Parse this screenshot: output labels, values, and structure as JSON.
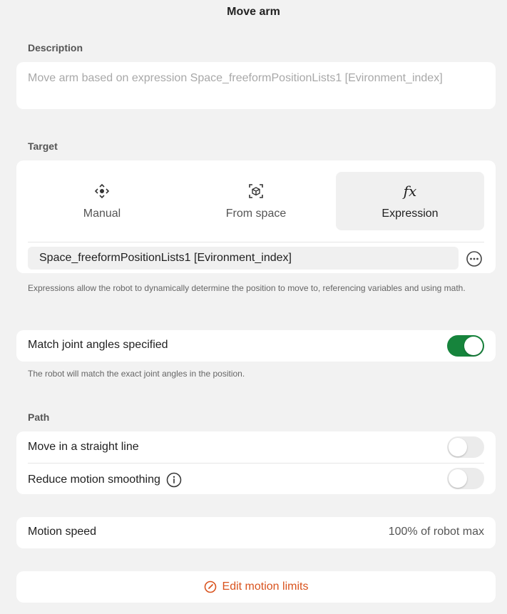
{
  "title": "Move arm",
  "description": {
    "label": "Description",
    "placeholder": "Move arm based on expression Space_freeformPositionLists1 [Evironment_index]"
  },
  "target": {
    "label": "Target",
    "options": [
      {
        "label": "Manual",
        "icon": "move-arrows-icon"
      },
      {
        "label": "From space",
        "icon": "cube-in-frame-icon"
      },
      {
        "label": "Expression",
        "icon": "fx-icon",
        "glyph": "fx",
        "selected": true
      }
    ],
    "expression_value": "Space_freeformPositionLists1 [Evironment_index]",
    "help": "Expressions allow the robot to dynamically determine the position to move to, referencing variables and using math."
  },
  "match_joints": {
    "label": "Match joint angles specified",
    "enabled": true,
    "help": "The robot will match the exact joint angles in the position."
  },
  "path": {
    "label": "Path",
    "straight_line": {
      "label": "Move in a straight line",
      "enabled": false
    },
    "reduce_smoothing": {
      "label": "Reduce motion smoothing",
      "enabled": false
    }
  },
  "speed": {
    "label": "Motion speed",
    "value": "100% of robot max"
  },
  "limits": {
    "label": "Edit motion limits"
  },
  "colors": {
    "accent_green": "#16843c",
    "link_orange": "#d9531e",
    "background": "#f2f2f2"
  }
}
